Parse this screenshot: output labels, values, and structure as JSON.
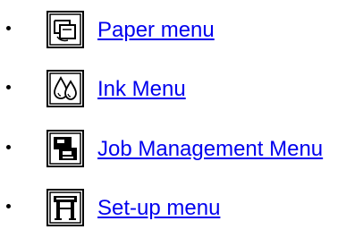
{
  "link_color": "#0000ee",
  "items": [
    {
      "label": "Paper menu",
      "icon": "paper-icon"
    },
    {
      "label": "Ink Menu",
      "icon": "ink-drops-icon"
    },
    {
      "label": "Job Management Menu",
      "icon": "job-management-icon"
    },
    {
      "label": "Set-up menu",
      "icon": "setup-printer-icon"
    }
  ]
}
